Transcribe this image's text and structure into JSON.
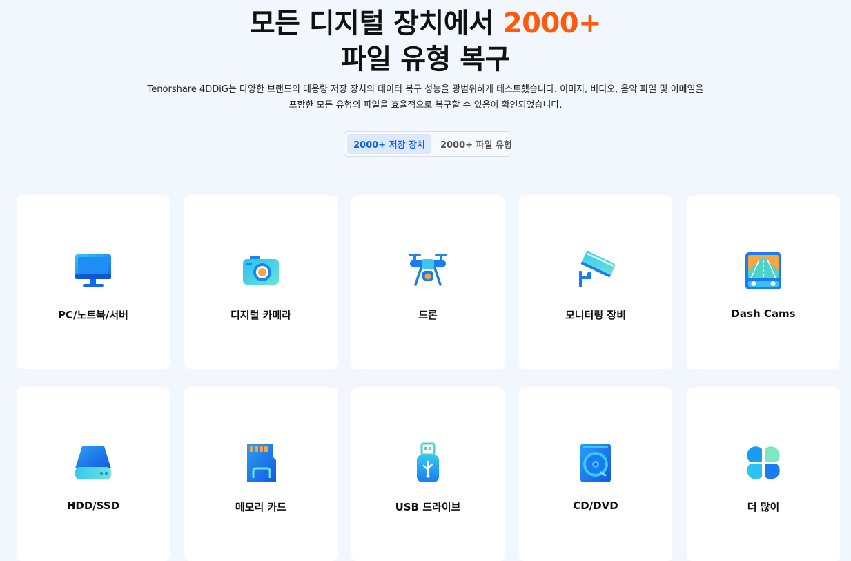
{
  "header": {
    "title_part1": "모든 디지털 장치에서 ",
    "title_accent": "2000+",
    "title_line2": "파일 유형 복구",
    "subtitle_line1": "Tenorshare 4DDiG는 다양한 브랜드의 대용량 저장 장치의 데이터 복구 성능을 광범위하게 테스트했습니다. 이미지, 비디오, 음악 파일 및 이메일을",
    "subtitle_line2": "포함한 모든 유형의 파일을 효율적으로 복구할 수 있음이 확인되었습니다.",
    "accent_color": "#ff5a0b"
  },
  "tabs": [
    {
      "label": "2000+ 저장 장치",
      "active": true
    },
    {
      "label": "2000+ 파일 유형",
      "active": false
    }
  ],
  "devices": [
    {
      "label": "PC/노트북/서버",
      "icon": "monitor-icon"
    },
    {
      "label": "디지털 카메라",
      "icon": "camera-icon"
    },
    {
      "label": "드론",
      "icon": "drone-icon"
    },
    {
      "label": "모니터링 장비",
      "icon": "surveillance-camera-icon"
    },
    {
      "label": "Dash Cams",
      "icon": "dash-cam-icon"
    },
    {
      "label": "HDD/SSD",
      "icon": "hard-drive-icon"
    },
    {
      "label": "메모리 카드",
      "icon": "memory-card-icon"
    },
    {
      "label": "USB 드라이브",
      "icon": "usb-drive-icon"
    },
    {
      "label": "CD/DVD",
      "icon": "disc-icon"
    },
    {
      "label": "더 많이",
      "icon": "more-icon"
    }
  ],
  "colors": {
    "active_tab": "#1364e0",
    "icon_blue": "#1a7cf2",
    "icon_cyan": "#3dd0e8"
  }
}
